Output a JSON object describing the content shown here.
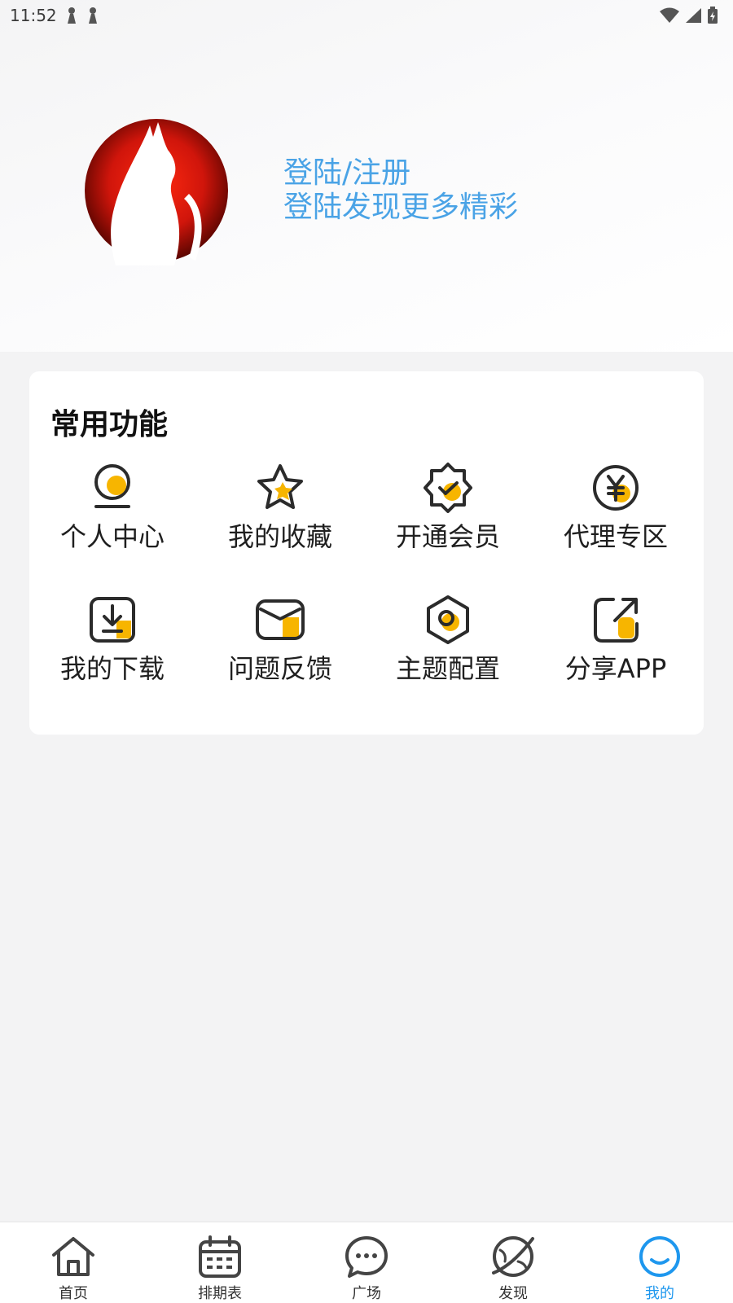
{
  "status_bar": {
    "time": "11:52"
  },
  "header": {
    "login_title": "登陆/注册",
    "login_subtitle": "登陆发现更多精彩"
  },
  "functions": {
    "title": "常用功能",
    "items": [
      {
        "label": "个人中心",
        "icon": "user-icon"
      },
      {
        "label": "我的收藏",
        "icon": "star-icon"
      },
      {
        "label": "开通会员",
        "icon": "vip-badge-icon"
      },
      {
        "label": "代理专区",
        "icon": "yen-icon"
      },
      {
        "label": "我的下载",
        "icon": "download-icon"
      },
      {
        "label": "问题反馈",
        "icon": "mail-icon"
      },
      {
        "label": "主题配置",
        "icon": "settings-hex-icon"
      },
      {
        "label": "分享APP",
        "icon": "share-icon"
      }
    ]
  },
  "bottom_nav": {
    "items": [
      {
        "label": "首页",
        "icon": "home-icon"
      },
      {
        "label": "排期表",
        "icon": "calendar-icon"
      },
      {
        "label": "广场",
        "icon": "chat-icon"
      },
      {
        "label": "发现",
        "icon": "planet-icon"
      },
      {
        "label": "我的",
        "icon": "smile-icon",
        "active": true
      }
    ]
  },
  "colors": {
    "accent_yellow": "#f7b500",
    "icon_dark": "#2b2b2b",
    "link_blue": "#4aa3e6",
    "nav_active": "#1e97ee",
    "avatar_red": "#d0150b"
  }
}
